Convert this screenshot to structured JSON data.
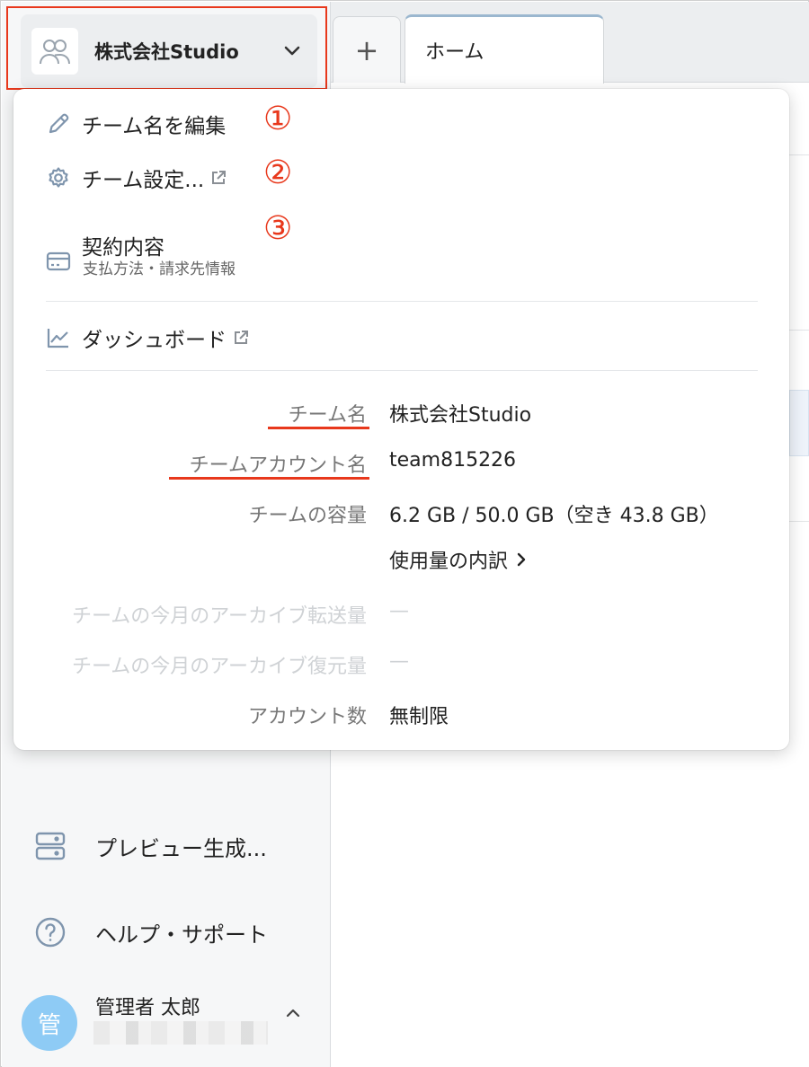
{
  "sidebar": {
    "team_switcher": {
      "name": "株式会社Studio",
      "icon": "team-icon"
    },
    "items": [
      {
        "label": "プレビュー生成...",
        "icon": "server-icon"
      },
      {
        "label": "ヘルプ・サポート",
        "icon": "help-icon"
      }
    ],
    "user": {
      "avatar_char": "管",
      "name": "管理者 太郎"
    }
  },
  "tabs": {
    "add_label": "+",
    "home_label": "ホーム"
  },
  "dropdown": {
    "menu": [
      {
        "label": "チーム名を編集",
        "icon": "pencil-icon",
        "marker": "①"
      },
      {
        "label": "チーム設定...",
        "icon": "gear-icon",
        "external": true,
        "marker": "②"
      },
      {
        "label": "契約内容",
        "sub": "支払方法・請求先情報",
        "icon": "card-icon",
        "marker": "③"
      },
      {
        "label": "ダッシュボード",
        "icon": "chart-icon",
        "external": true
      }
    ],
    "info": [
      {
        "label": "チーム名",
        "value": "株式会社Studio"
      },
      {
        "label": "チームアカウント名",
        "value": "team815226"
      },
      {
        "label": "チームの容量",
        "value": "6.2 GB / 50.0 GB（空き 43.8 GB）"
      },
      {
        "label": "チームの今月のアーカイブ転送量",
        "value": "—"
      },
      {
        "label": "チームの今月のアーカイブ復元量",
        "value": "—"
      },
      {
        "label": "アカウント数",
        "value": "無制限"
      }
    ],
    "usage_link": "使用量の内訳"
  },
  "colors": {
    "annotation": "#e8381c",
    "avatar": "#8ecbf5",
    "icon": "#7f95ad"
  }
}
